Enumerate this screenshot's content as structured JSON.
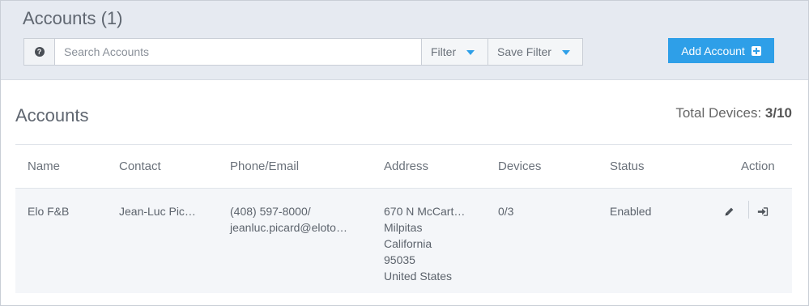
{
  "header": {
    "title": "Accounts (1)",
    "search": {
      "placeholder": "Search Accounts",
      "value": ""
    },
    "filter_label": "Filter",
    "save_filter_label": "Save Filter",
    "add_account_label": "Add Account"
  },
  "section": {
    "title": "Accounts",
    "total_devices_label": "Total Devices:",
    "total_devices_value": "3/10"
  },
  "table": {
    "columns": [
      "Name",
      "Contact",
      "Phone/Email",
      "Address",
      "Devices",
      "Status",
      "Action"
    ],
    "rows": [
      {
        "name": "Elo F&B",
        "contact": "Jean-Luc Pic…",
        "phone": "(408) 597-8000/",
        "email": "jeanluc.picard@eloto…",
        "address": [
          "670 N McCart…",
          "Milpitas",
          "California",
          "95035",
          "United States"
        ],
        "devices": "0/3",
        "status": "Enabled"
      }
    ]
  },
  "colors": {
    "accent": "#2e9fe8",
    "header_bg": "#e6eaf1",
    "row_bg": "#f4f6f9"
  },
  "icons": {
    "help": "question-circle-icon",
    "caret": "caret-down-icon",
    "add": "plus-square-icon",
    "edit": "pencil-icon",
    "login": "sign-in-icon"
  }
}
